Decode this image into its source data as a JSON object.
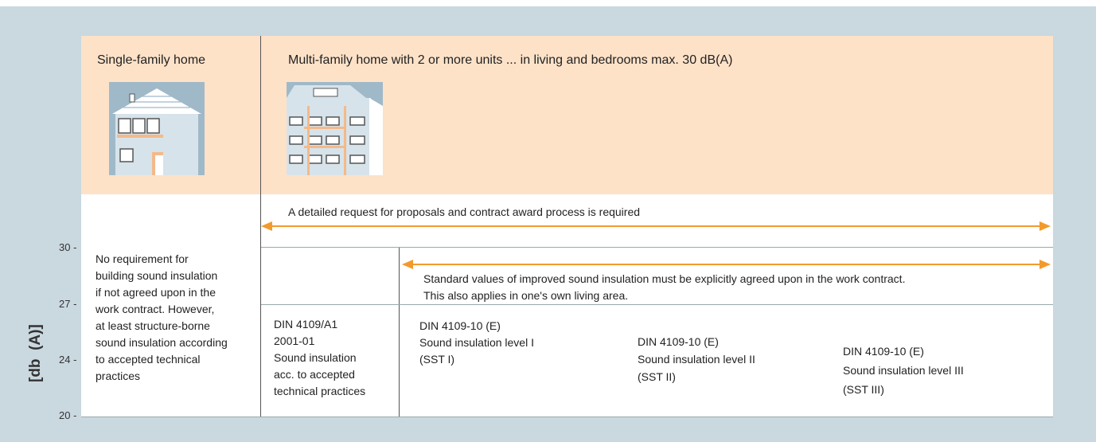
{
  "header": {
    "single_family": "Single-family home",
    "multi_family": "Multi-family home with 2 or more units ... in living and bedrooms max. 30 dB(A)"
  },
  "arrows": {
    "top_text": "A detailed request for proposals and contract award process is required",
    "mid_text_line1": "Standard values of improved sound insulation must be explicitly agreed upon in the work contract.",
    "mid_text_line2": "This also applies in one's own living area."
  },
  "left_note": [
    "No requirement for",
    "building sound insulation",
    "if not agreed upon in the",
    "work contract. However,",
    "at least structure-borne",
    "sound insulation according",
    "to accepted technical",
    "practices"
  ],
  "standards": {
    "din_a1": [
      "DIN 4109/A1",
      "2001-01",
      "Sound insulation",
      "acc. to accepted",
      "technical practices"
    ],
    "sst1": [
      "DIN 4109-10 (E)",
      "Sound insulation level I",
      "(SST I)"
    ],
    "sst2": [
      "DIN 4109-10 (E)",
      "Sound insulation level II",
      "(SST II)"
    ],
    "sst3": [
      "DIN 4109-10 (E)",
      "Sound insulation level III",
      "(SST III)"
    ]
  },
  "axis": {
    "title": "[db  (A)]",
    "ticks": [
      "30 -",
      "27 -",
      "24 -",
      "20 -"
    ]
  },
  "colors": {
    "header_bg": "#fde2c8",
    "frame_bg": "#cad8e0",
    "arrow": "#f39a2c",
    "house_bg": "#9fb9c9"
  }
}
